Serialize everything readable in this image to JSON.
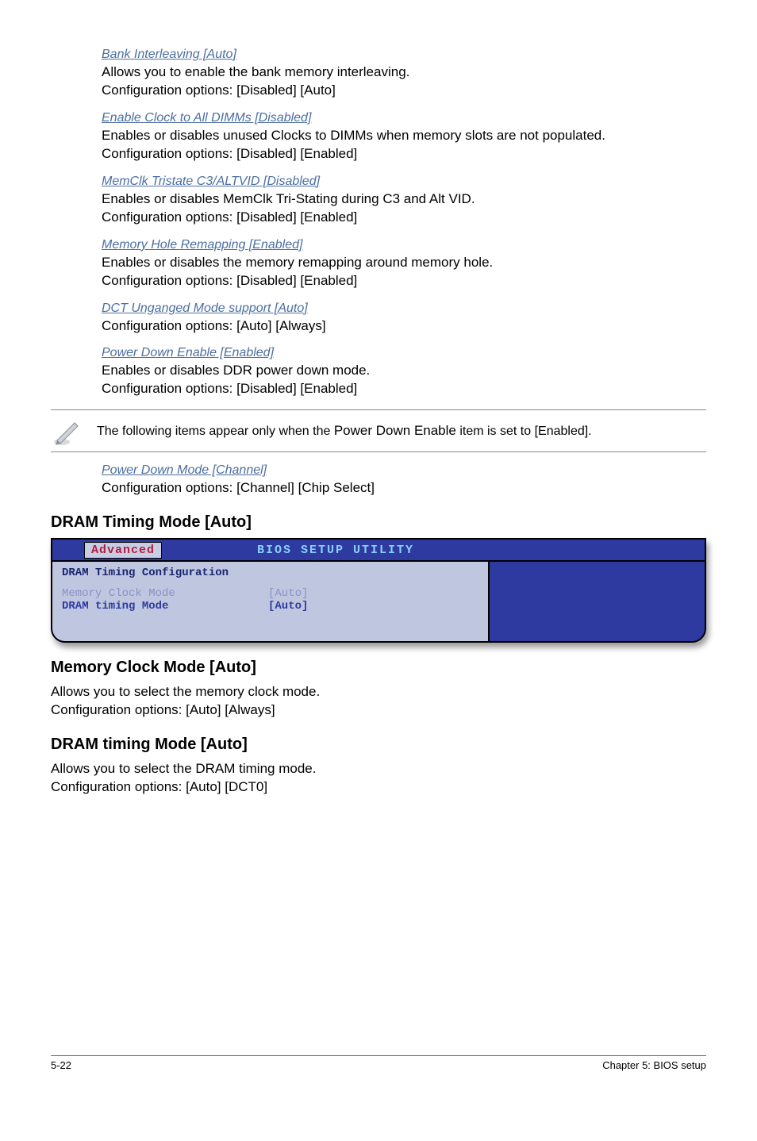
{
  "items": [
    {
      "heading": "Bank Interleaving [Auto]",
      "body": "Allows you to enable the bank memory interleaving.\nConfiguration options: [Disabled] [Auto]"
    },
    {
      "heading": "Enable Clock to All DIMMs [Disabled]",
      "body": "Enables or disables unused Clocks to DIMMs when memory slots are not populated.\nConfiguration options: [Disabled] [Enabled]"
    },
    {
      "heading": "MemClk Tristate C3/ALTVID [Disabled]",
      "body": "Enables or disables MemClk Tri-Stating during C3 and Alt VID.\nConfiguration options: [Disabled] [Enabled]"
    },
    {
      "heading": "Memory Hole Remapping [Enabled]",
      "body": "Enables or disables the memory remapping around memory hole.\nConfiguration options: [Disabled] [Enabled]"
    },
    {
      "heading": "DCT Unganged Mode support [Auto]",
      "body": "Configuration options: [Auto] [Always]"
    },
    {
      "heading": "Power Down Enable [Enabled]",
      "body": "Enables or disables DDR power down mode.\nConfiguration options: [Disabled] [Enabled]"
    }
  ],
  "note": {
    "prefix": "The following items appear only when the ",
    "bold": "Power Down Enable",
    "suffix": " item is set to [Enabled]."
  },
  "afterNote": {
    "heading": "Power Down Mode [Channel]",
    "body": "Configuration options: [Channel] [Chip Select]"
  },
  "sections": [
    {
      "title": "DRAM Timing Mode [Auto]"
    }
  ],
  "bios": {
    "headerTitle": "BIOS SETUP UTILITY",
    "tab": "Advanced",
    "panelTitle": "DRAM Timing Configuration",
    "rows": [
      {
        "label": "Memory Clock Mode",
        "value": "[Auto]",
        "dim": true
      },
      {
        "label": "DRAM timing Mode",
        "value": "[Auto]",
        "dim": false
      }
    ]
  },
  "postSections": [
    {
      "title": "Memory Clock Mode [Auto]",
      "body": "Allows you to select the memory clock mode.\nConfiguration options: [Auto] [Always]"
    },
    {
      "title": "DRAM timing Mode [Auto]",
      "body": "Allows you to select the DRAM timing mode.\nConfiguration options: [Auto] [DCT0]"
    }
  ],
  "footer": {
    "left": "5-22",
    "right": "Chapter 5: BIOS setup"
  }
}
